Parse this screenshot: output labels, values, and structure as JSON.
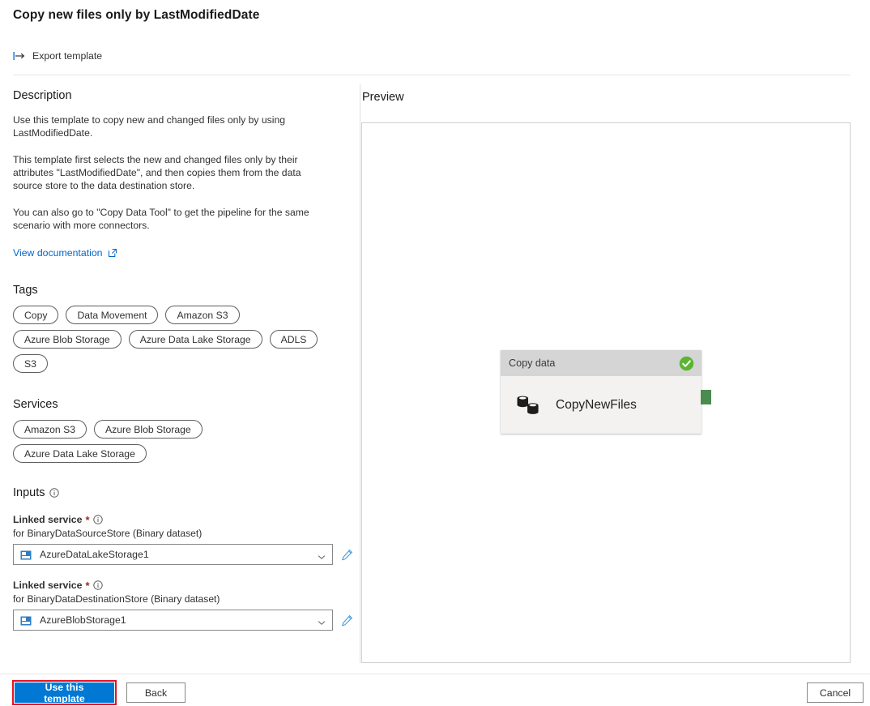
{
  "header": {
    "title": "Copy new files only by LastModifiedDate",
    "export_label": "Export template",
    "export_icon": "export-arrow-icon"
  },
  "description": {
    "heading": "Description",
    "paragraphs": [
      "Use this template to copy new and changed files only by using LastModifiedDate.",
      "This template first selects the new and changed files only by their attributes \"LastModifiedDate\", and then copies them from the data source store to the data destination store.",
      "You can also go to \"Copy Data Tool\" to get the pipeline for the same scenario with more connectors."
    ],
    "doc_link": "View documentation",
    "doc_link_icon": "external-link-icon"
  },
  "tags": {
    "heading": "Tags",
    "items": [
      "Copy",
      "Data Movement",
      "Amazon S3",
      "Azure Blob Storage",
      "Azure Data Lake Storage",
      "ADLS",
      "S3"
    ]
  },
  "services": {
    "heading": "Services",
    "items": [
      "Amazon S3",
      "Azure Blob Storage",
      "Azure Data Lake Storage"
    ]
  },
  "inputs": {
    "heading": "Inputs",
    "info_icon": "info-icon",
    "fields": [
      {
        "label": "Linked service",
        "required_marker": "*",
        "sublabel": "for BinaryDataSourceStore (Binary dataset)",
        "value": "AzureDataLakeStorage1",
        "value_icon": "linked-service-icon",
        "chevron_icon": "chevron-down-icon",
        "edit_icon": "pencil-icon"
      },
      {
        "label": "Linked service",
        "required_marker": "*",
        "sublabel": "for BinaryDataDestinationStore (Binary dataset)",
        "value": "AzureBlobStorage1",
        "value_icon": "linked-service-icon",
        "chevron_icon": "chevron-down-icon",
        "edit_icon": "pencil-icon"
      }
    ]
  },
  "preview": {
    "heading": "Preview",
    "node": {
      "header_label": "Copy data",
      "status_icon": "success-check-icon",
      "activity_icon": "copy-data-database-icon",
      "name": "CopyNewFiles",
      "output_port": "output-connector"
    }
  },
  "footer": {
    "use_template": "Use this template",
    "back": "Back",
    "cancel": "Cancel"
  },
  "colors": {
    "primary": "#0078d4",
    "highlight": "#e81123",
    "success": "#5cb531",
    "port": "#4a8b4f",
    "link": "#0066cc",
    "required": "#a4262c"
  }
}
